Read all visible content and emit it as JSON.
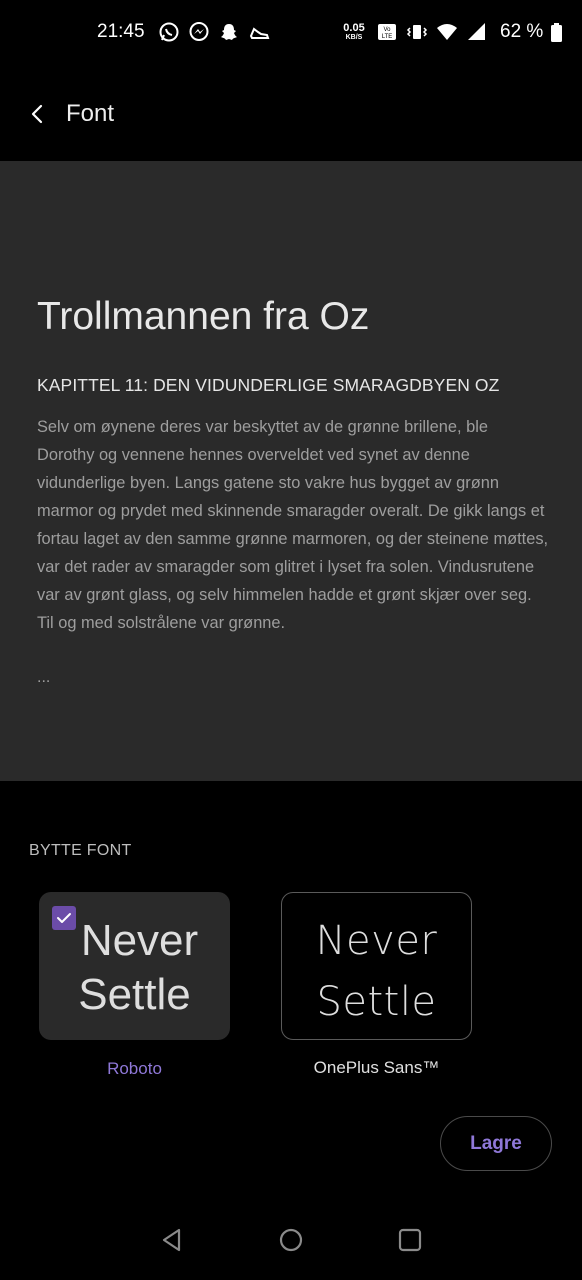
{
  "status_bar": {
    "time": "21:45",
    "notification_icons": [
      "whatsapp-icon",
      "messenger-icon",
      "snapchat-icon",
      "shoe-icon"
    ],
    "net_speed_value": "0.05",
    "net_speed_unit": "KB/S",
    "volte_label": "Vo LTE",
    "battery_percent": "62 %"
  },
  "app_bar": {
    "title": "Font"
  },
  "preview": {
    "title": "Trollmannen fra Oz",
    "heading": "KAPITTEL 11: DEN VIDUNDERLIGE SMARAGDBYEN OZ",
    "body": "Selv om øynene deres var beskyttet av de grønne brillene, ble Dorothy og vennene hennes overveldet ved synet av denne vidunderlige byen. Langs gatene sto vakre hus bygget av grønn marmor og prydet med skinnende smaragder overalt. De gikk langs et fortau laget av den samme grønne marmoren, og der steinene møttes, var det rader av smaragder som glitret i lyset fra solen. Vindusrutene var av grønt glass, og selv himmelen hadde et grønt skjær over seg. Til og med solstrålene var grønne.",
    "ellipsis": "..."
  },
  "font_section": {
    "label": "BYTTE FONT",
    "options": [
      {
        "sample_line1": "Never",
        "sample_line2": "Settle",
        "name": "Roboto",
        "selected": true
      },
      {
        "sample_line1": "Never",
        "sample_line2": "Settle",
        "name": "OnePlus Sans™",
        "selected": false
      }
    ]
  },
  "save_button": {
    "label": "Lagre"
  },
  "colors": {
    "accent": "#8f78d8",
    "checkbox": "#6b4ca8",
    "preview_bg": "#2a2a2a",
    "background": "#000000"
  }
}
